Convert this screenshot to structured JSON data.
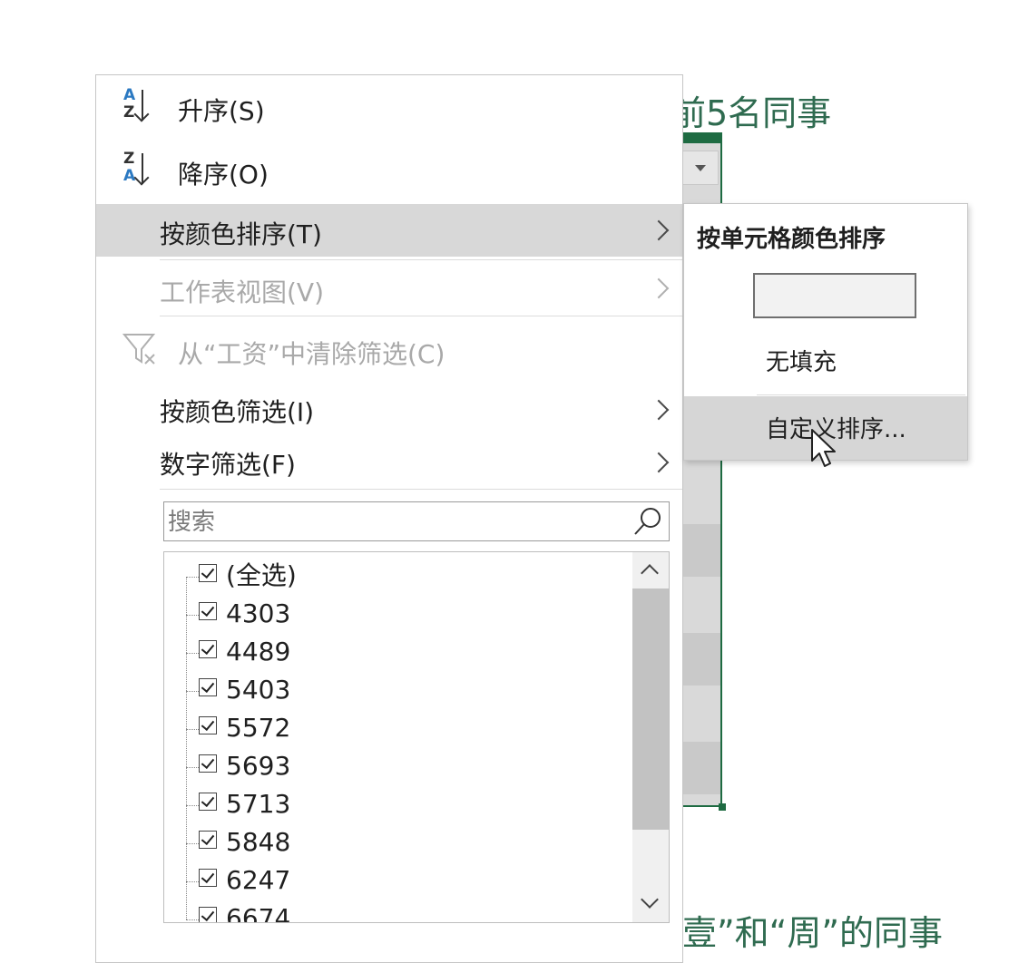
{
  "background": {
    "title_top": "前5名同事",
    "title_bottom": "壹”和“周”的同事"
  },
  "menu": {
    "sort_asc": "升序(S)",
    "sort_desc": "降序(O)",
    "sort_by_color": "按颜色排序(T)",
    "sheet_view": "工作表视图(V)",
    "clear_filter": "从“工资”中清除筛选(C)",
    "filter_by_color": "按颜色筛选(I)",
    "number_filter": "数字筛选(F)",
    "search_placeholder": "搜索",
    "list_items": [
      "(全选)",
      "4303",
      "4489",
      "5403",
      "5572",
      "5693",
      "5713",
      "5848",
      "6247",
      "6674"
    ]
  },
  "submenu": {
    "title": "按单元格颜色排序",
    "no_fill": "无填充",
    "custom_sort": "自定义排序..."
  },
  "colors": {
    "accent_green": "#1e6b42",
    "title_green": "#2f6b50",
    "sort_icon_blue": "#2b79c2",
    "highlight": "#d8d8d8"
  },
  "icons": [
    "sort-ascending-icon",
    "sort-descending-icon",
    "clear-filter-icon",
    "search-icon",
    "chevron-right-icon",
    "scroll-up-icon",
    "scroll-down-icon",
    "mouse-cursor-icon"
  ]
}
